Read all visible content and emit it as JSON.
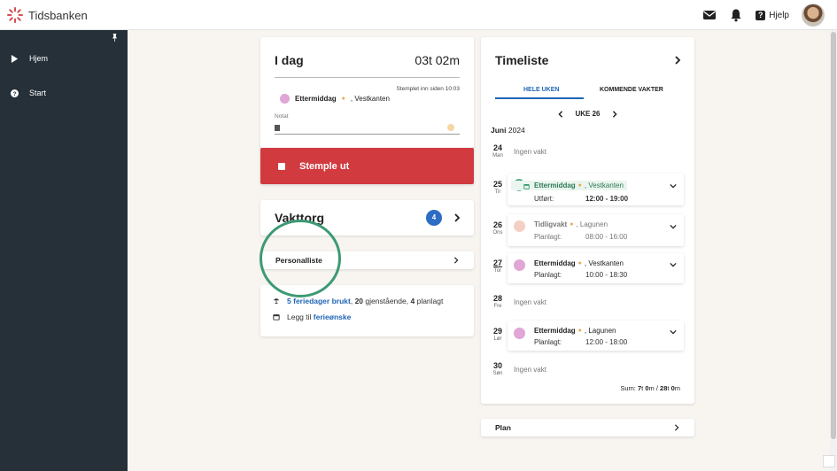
{
  "app": {
    "brand": "Tidsbanken"
  },
  "header": {
    "help_label": "Hjelp"
  },
  "sidebar": {
    "items": [
      {
        "label": "Hjem"
      },
      {
        "label": "Start"
      }
    ]
  },
  "today": {
    "title": "I dag",
    "duration": "03t 02m",
    "stamped": "Stemplet inn siden 10:03",
    "shift_name": "Ettermiddag",
    "shift_location": ", Vestkanten",
    "note_label": "Notat",
    "clock_out_label": "Stemple ut"
  },
  "vakttorg": {
    "title": "Vakttorg",
    "count": "4"
  },
  "personalliste": {
    "label": "Personalliste"
  },
  "vacation": {
    "used_count": "5",
    "used_label": "feriedager brukt",
    "remaining_count": "20",
    "remaining_label": "gjenstående,",
    "planned_count": "4",
    "planned_label": "planlagt",
    "add_prefix": "Legg til",
    "add_link": "ferieønske"
  },
  "timeliste": {
    "title": "Timeliste",
    "tab_all": "HELE UKEN",
    "tab_upcoming": "KOMMENDE VAKTER",
    "week": "UKE 26",
    "month": "Juni",
    "year": "2024",
    "days": [
      {
        "num": "24",
        "weekday": "Man",
        "empty": "Ingen vakt"
      },
      {
        "num": "25",
        "weekday": "Tir",
        "name": "Ettermiddag",
        "loc": ", Vestkanten",
        "status": "Utført:",
        "time": "12:00 - 19:00"
      },
      {
        "num": "26",
        "weekday": "Ons",
        "name": "Tidligvakt",
        "loc": ", Lagunen",
        "status": "Planlagt:",
        "time": "08:00 - 16:00"
      },
      {
        "num": "27",
        "weekday": "Tor",
        "name": "Ettermiddag",
        "loc": ", Vestkanten",
        "status": "Planlagt:",
        "time": "10:00 - 18:30"
      },
      {
        "num": "28",
        "weekday": "Fre",
        "empty": "Ingen vakt"
      },
      {
        "num": "29",
        "weekday": "Lør",
        "name": "Ettermiddag",
        "loc": ", Lagunen",
        "status": "Planlagt:",
        "time": "12:00 - 18:00"
      },
      {
        "num": "30",
        "weekday": "Søn",
        "empty": "Ingen vakt"
      }
    ],
    "sum_label": "Sum:",
    "sum_h1": "7",
    "sum_t1": "t",
    "sum_m1": "0",
    "sum_mu1": "m /",
    "sum_h2": "28",
    "sum_t2": "t",
    "sum_m2": "0",
    "sum_mu2": "m"
  },
  "plan": {
    "label": "Plan"
  },
  "colors": {
    "accent": "#1f65b5",
    "stample": "#d13a3f",
    "ring": "#3d9a74",
    "pink": "#e0a6d6",
    "peach": "#f5cfc4",
    "green": "#2e9b6a"
  }
}
